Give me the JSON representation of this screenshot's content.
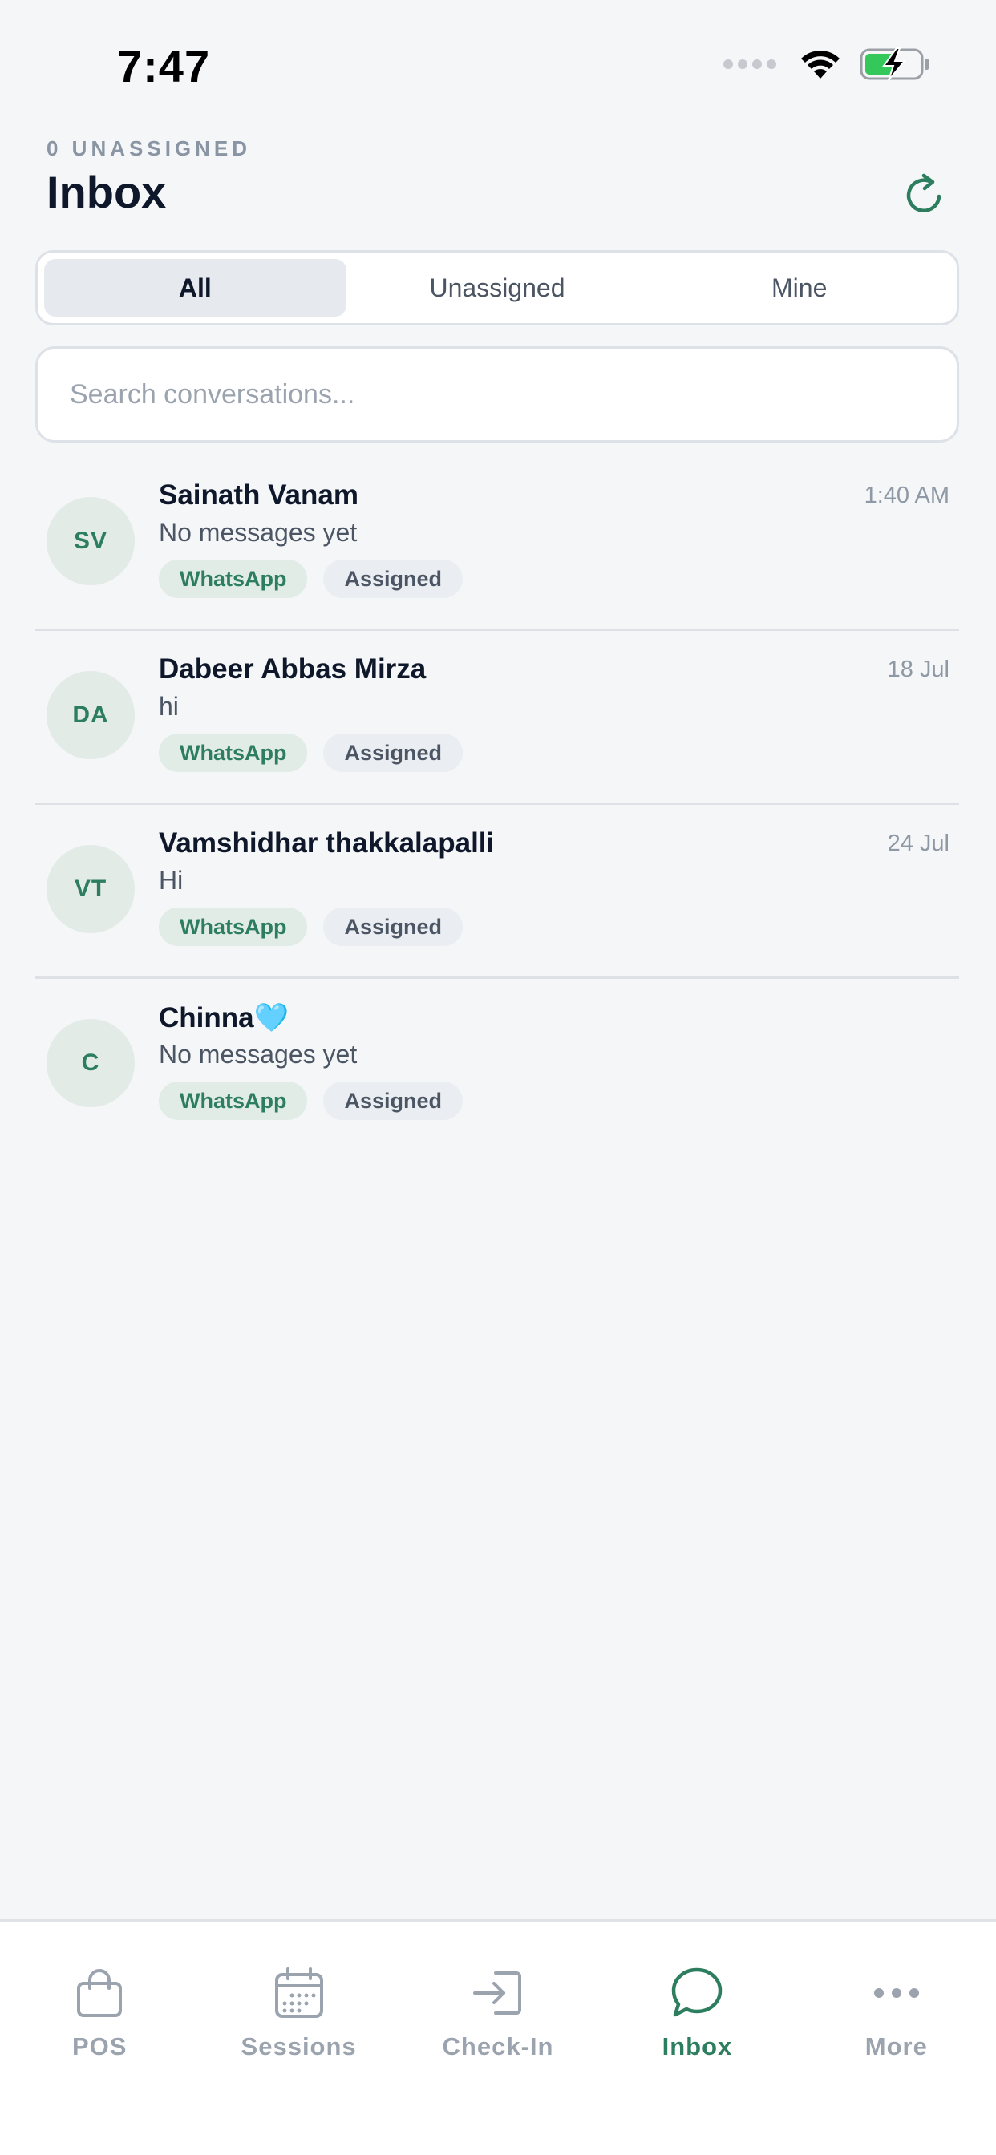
{
  "status_bar": {
    "time": "7:47"
  },
  "header": {
    "kicker": "0 UNASSIGNED",
    "title": "Inbox"
  },
  "tabs": [
    {
      "label": "All",
      "active": true
    },
    {
      "label": "Unassigned",
      "active": false
    },
    {
      "label": "Mine",
      "active": false
    }
  ],
  "search": {
    "placeholder": "Search conversations...",
    "value": ""
  },
  "conversations": [
    {
      "initials": "SV",
      "name": "Sainath Vanam",
      "time": "1:40 AM",
      "preview": "No messages yet",
      "channel": "WhatsApp",
      "status": "Assigned"
    },
    {
      "initials": "DA",
      "name": "Dabeer Abbas Mirza",
      "time": "18 Jul",
      "preview": "hi",
      "channel": "WhatsApp",
      "status": "Assigned"
    },
    {
      "initials": "VT",
      "name": "Vamshidhar thakkalapalli",
      "time": "24 Jul",
      "preview": "Hi",
      "channel": "WhatsApp",
      "status": "Assigned"
    },
    {
      "initials": "C",
      "name": "Chinna🩵",
      "time": "",
      "preview": "No messages yet",
      "channel": "WhatsApp",
      "status": "Assigned"
    }
  ],
  "bottom_nav": [
    {
      "label": "POS",
      "icon": "shopping-bag-icon",
      "active": false
    },
    {
      "label": "Sessions",
      "icon": "calendar-icon",
      "active": false
    },
    {
      "label": "Check-In",
      "icon": "sign-in-icon",
      "active": false
    },
    {
      "label": "Inbox",
      "icon": "chat-bubble-icon",
      "active": true
    },
    {
      "label": "More",
      "icon": "more-dots-icon",
      "active": false
    }
  ],
  "colors": {
    "accent": "#2d7d5f",
    "background": "#f4f6f8",
    "muted": "#9aa3ae"
  }
}
